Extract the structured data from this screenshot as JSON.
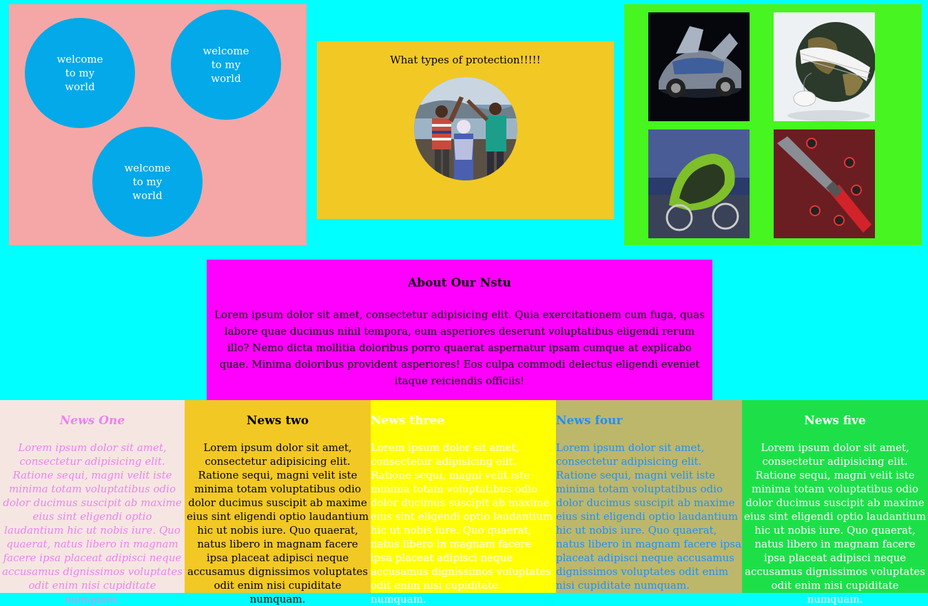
{
  "circles": {
    "c1": "welcome to my world",
    "c2": "welcome to my world",
    "c3": "welcome to my world"
  },
  "protection": {
    "title": "What types of protection!!!!!"
  },
  "gallery": {
    "images": [
      "concept-car",
      "globe-keyboard",
      "green-bike",
      "knife-infographic"
    ]
  },
  "about": {
    "title": "About Our Nstu",
    "body": "Lorem ipsum dolor sit amet, consectetur adipisicing elit. Quia exercitationem cum fuga, quas labore quae ducimus nihil tempora, eum asperiores deserunt voluptatibus eligendi rerum illo? Nemo dicta mollitia doloribus porro quaerat aspernatur ipsam cumque at explicabo quae. Minima doloribus provident asperiores! Eos culpa commodi delectus eligendi eveniet itaque reiciendis officiis!"
  },
  "news": [
    {
      "title": "News One",
      "body": "Lorem ipsum dolor sit amet, consectetur adipisicing elit. Ratione sequi, magni velit iste minima totam voluptatibus odio dolor ducimus suscipit ab maxime eius sint eligendi optio laudantium hic ut nobis iure. Quo quaerat, natus libero in magnam facere ipsa placeat adipisci neque accusamus dignissimos voluptates odit enim nisi cupiditate numquam."
    },
    {
      "title": "News two",
      "body": "Lorem ipsum dolor sit amet, consectetur adipisicing elit. Ratione sequi, magni velit iste minima totam voluptatibus odio dolor ducimus suscipit ab maxime eius sint eligendi optio laudantium hic ut nobis iure. Quo quaerat, natus libero in magnam facere ipsa placeat adipisci neque accusamus dignissimos voluptates odit enim nisi cupiditate numquam."
    },
    {
      "title": "News three",
      "body": "Lorem ipsum dolor sit amet, consectetur adipisicing elit. Ratione sequi, magni velit iste minima totam voluptatibus odio dolor ducimus suscipit ab maxime eius sint eligendi optio laudantium hic ut nobis iure. Quo quaerat, natus libero in magnam facere ipsa placeat adipisci neque accusamus dignissimos voluptates odit enim nisi cupiditate numquam."
    },
    {
      "title": "News four",
      "body": "Lorem ipsum dolor sit amet, consectetur adipisicing elit. Ratione sequi, magni velit iste minima totam voluptatibus odio dolor ducimus suscipit ab maxime eius sint eligendi optio laudantium hic ut nobis iure. Quo quaerat, natus libero in magnam facere ipsa placeat adipisci neque accusamus dignissimos voluptates odit enim nisi cupiditate numquam."
    },
    {
      "title": "News five",
      "body": "Lorem ipsum dolor sit amet, consectetur adipisicing elit. Ratione sequi, magni velit iste minima totam voluptatibus odio dolor ducimus suscipit ab maxime eius sint eligendi optio laudantium hic ut nobis iure. Quo quaerat, natus libero in magnam facere ipsa placeat adipisci neque accusamus dignissimos voluptates odit enim nisi cupiditate numquam."
    }
  ]
}
